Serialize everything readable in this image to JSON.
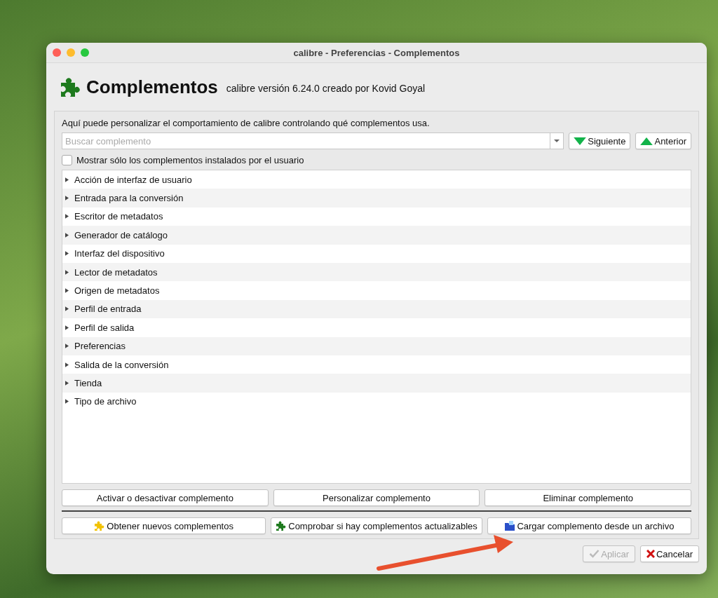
{
  "window": {
    "title": "calibre - Preferencias - Complementos"
  },
  "header": {
    "title": "Complementos",
    "version": "calibre versión 6.24.0 creado por Kovid Goyal"
  },
  "description": "Aquí puede personalizar el comportamiento de calibre controlando qué complementos usa.",
  "search": {
    "placeholder": "Buscar complemento"
  },
  "nav_buttons": [
    {
      "label": "Siguiente",
      "kind": "down"
    },
    {
      "label": "Anterior",
      "kind": "up"
    }
  ],
  "user_only": {
    "label": "Mostrar sólo los complementos instalados por el usuario",
    "checked": false
  },
  "categories": [
    {
      "label": "Acción de interfaz de usuario",
      "expanded": false
    },
    {
      "label": "Entrada para la conversión",
      "expanded": false
    },
    {
      "label": "Escritor de metadatos",
      "expanded": false
    },
    {
      "label": "Generador de catálogo",
      "expanded": false
    },
    {
      "label": "Interfaz del dispositivo",
      "expanded": false
    },
    {
      "label": "Lector de metadatos",
      "expanded": false
    },
    {
      "label": "Origen de metadatos",
      "expanded": false
    },
    {
      "label": "Perfil de entrada",
      "expanded": false
    },
    {
      "label": "Perfil de salida",
      "expanded": false
    },
    {
      "label": "Preferencias",
      "expanded": false
    },
    {
      "label": "Salida de la conversión",
      "expanded": false
    },
    {
      "label": "Tienda",
      "expanded": false
    },
    {
      "label": "Tipo de archivo",
      "expanded": false
    }
  ],
  "action_buttons": [
    "Activar o desactivar complemento",
    "Personalizar complemento",
    "Eliminar complemento"
  ],
  "plugin_buttons": [
    {
      "label": "Obtener nuevos complementos",
      "kind": "get"
    },
    {
      "label": "Comprobar si hay complementos actualizables",
      "kind": "check"
    },
    {
      "label": "Cargar complemento desde un archivo",
      "kind": "load"
    }
  ],
  "dialog_buttons": [
    {
      "label": "Aplicar",
      "kind": "apply",
      "disabled": true
    },
    {
      "label": "Cancelar",
      "kind": "cancel",
      "disabled": false
    }
  ]
}
